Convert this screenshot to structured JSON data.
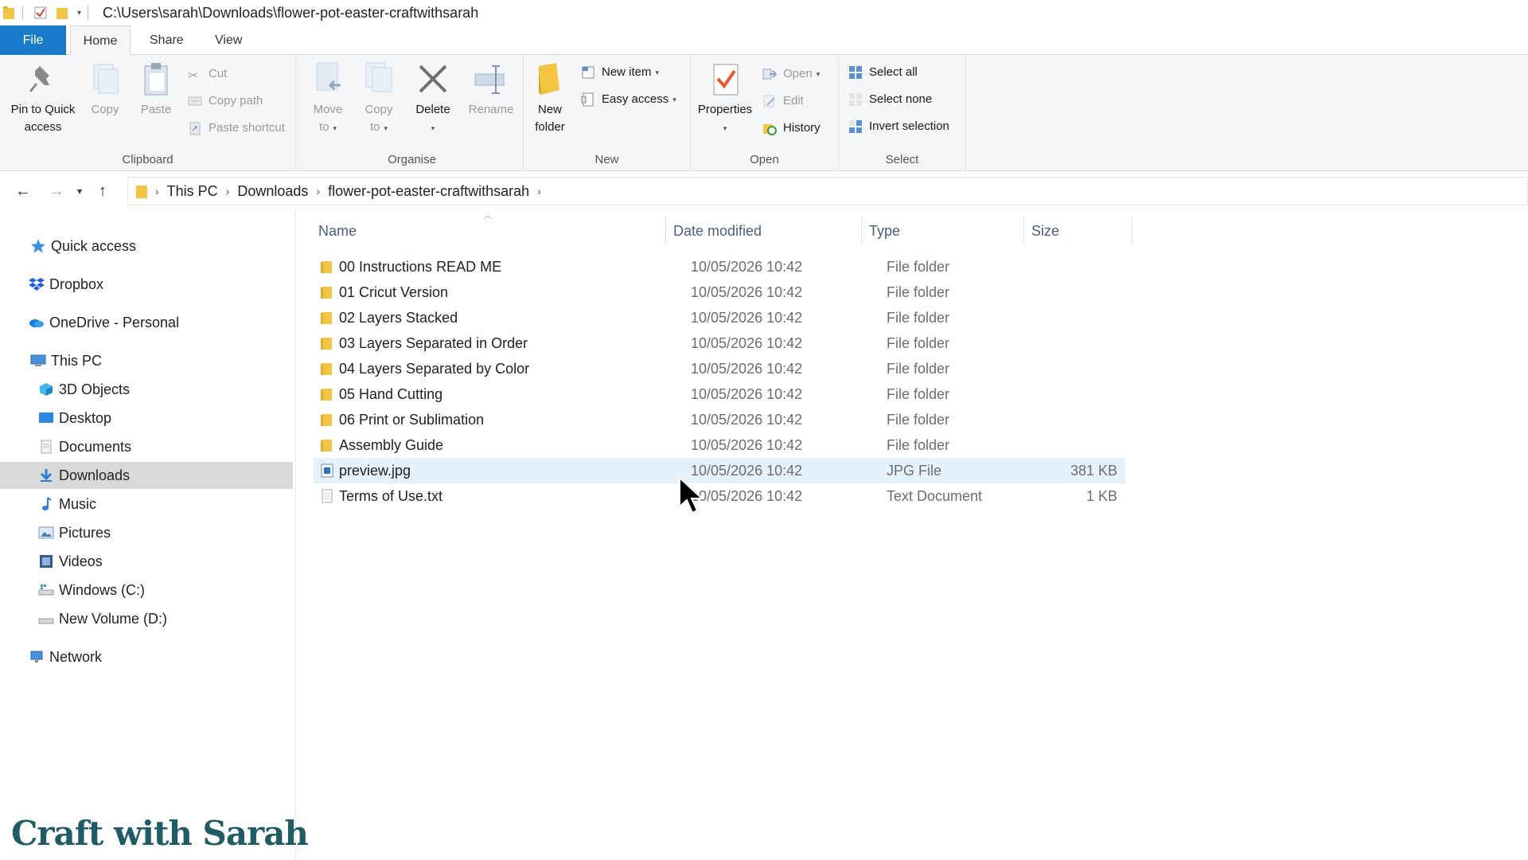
{
  "window": {
    "title_path": "C:\\Users\\sarah\\Downloads\\flower-pot-easter-craftwithsarah"
  },
  "tabs": [
    {
      "label": "File"
    },
    {
      "label": "Home"
    },
    {
      "label": "Share"
    },
    {
      "label": "View"
    }
  ],
  "ribbon": {
    "clipboard": {
      "label": "Clipboard",
      "pin_line1": "Pin to Quick",
      "pin_line2": "access",
      "copy": "Copy",
      "paste": "Paste",
      "cut": "Cut",
      "copy_path": "Copy path",
      "paste_shortcut": "Paste shortcut"
    },
    "organise": {
      "label": "Organise",
      "move_line1": "Move",
      "move_line2": "to",
      "copy_line1": "Copy",
      "copy_line2": "to",
      "delete": "Delete",
      "rename": "Rename"
    },
    "new": {
      "label": "New",
      "new_folder_line1": "New",
      "new_folder_line2": "folder",
      "new_item": "New item",
      "easy_access": "Easy access"
    },
    "open": {
      "label": "Open",
      "properties": "Properties",
      "open": "Open",
      "edit": "Edit",
      "history": "History"
    },
    "select": {
      "label": "Select",
      "select_all": "Select all",
      "select_none": "Select none",
      "invert_selection": "Invert selection"
    }
  },
  "address": {
    "crumbs": [
      "This PC",
      "Downloads",
      "flower-pot-easter-craftwithsarah"
    ]
  },
  "navpane": {
    "items": [
      {
        "label": "Quick access"
      },
      {
        "label": "Dropbox"
      },
      {
        "label": "OneDrive - Personal"
      },
      {
        "label": "This PC"
      },
      {
        "label": "3D Objects"
      },
      {
        "label": "Desktop"
      },
      {
        "label": "Documents"
      },
      {
        "label": "Downloads"
      },
      {
        "label": "Music"
      },
      {
        "label": "Pictures"
      },
      {
        "label": "Videos"
      },
      {
        "label": "Windows (C:)"
      },
      {
        "label": "New Volume (D:)"
      },
      {
        "label": "Network"
      }
    ],
    "selected": "Downloads"
  },
  "columns": {
    "name": "Name",
    "date": "Date modified",
    "type": "Type",
    "size": "Size"
  },
  "files": [
    {
      "name": "00 Instructions READ ME",
      "date": "10/05/2026 10:42",
      "type": "File folder",
      "size": ""
    },
    {
      "name": "01 Cricut Version",
      "date": "10/05/2026 10:42",
      "type": "File folder",
      "size": ""
    },
    {
      "name": "02 Layers Stacked",
      "date": "10/05/2026 10:42",
      "type": "File folder",
      "size": ""
    },
    {
      "name": "03 Layers Separated in Order",
      "date": "10/05/2026 10:42",
      "type": "File folder",
      "size": ""
    },
    {
      "name": "04 Layers Separated by Color",
      "date": "10/05/2026 10:42",
      "type": "File folder",
      "size": ""
    },
    {
      "name": "05 Hand Cutting",
      "date": "10/05/2026 10:42",
      "type": "File folder",
      "size": ""
    },
    {
      "name": "06 Print or Sublimation",
      "date": "10/05/2026 10:42",
      "type": "File folder",
      "size": ""
    },
    {
      "name": "Assembly Guide",
      "date": "10/05/2026 10:42",
      "type": "File folder",
      "size": ""
    },
    {
      "name": "preview.jpg",
      "date": "10/05/2026 10:42",
      "type": "JPG File",
      "size": "381 KB"
    },
    {
      "name": "Terms of Use.txt",
      "date": "10/05/2026 10:42",
      "type": "Text Document",
      "size": "1 KB"
    }
  ],
  "watermark": "Craft with Sarah",
  "colors": {
    "accent": "#1979ca",
    "folder": "#f4c542",
    "selection": "#e5f1fb",
    "nav_selected": "#d9d9d9",
    "header_text": "#4c607a"
  }
}
